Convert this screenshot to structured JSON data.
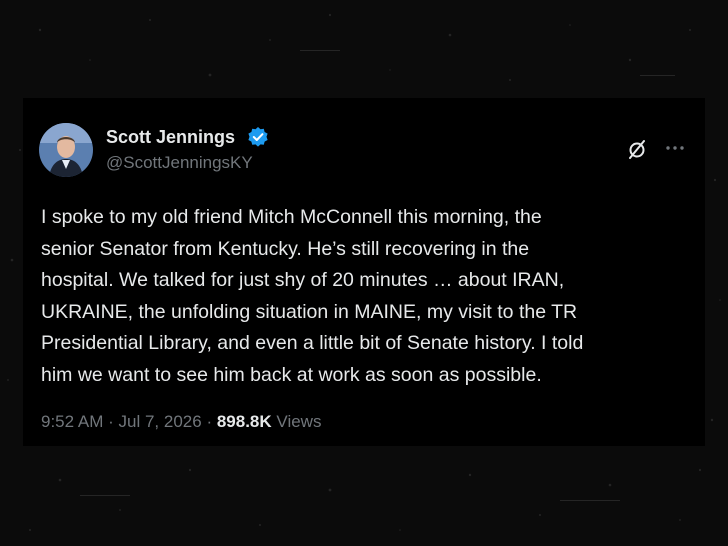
{
  "author": {
    "display_name": "Scott Jennings",
    "handle": "@ScottJenningsKY",
    "verified": true
  },
  "tweet": {
    "text_lines": [
      "I spoke to my old friend Mitch McConnell this morning, the",
      "senior Senator from Kentucky. He’s still recovering in the",
      "hospital. We talked for just shy of 20 minutes … about IRAN,",
      "UKRAINE, the unfolding situation in MAINE, my visit to the TR",
      "Presidential Library, and even a little bit of Senate history. I told",
      "him we want to see him back at work as soon as possible."
    ]
  },
  "meta": {
    "time": "9:52 AM",
    "separator": "·",
    "date": "Jul 7, 2026",
    "views_count": "898.8K",
    "views_label": "Views"
  },
  "icons": {
    "verified": "verified-badge-icon",
    "grok": "grok-icon",
    "more": "more-options-icon"
  },
  "colors": {
    "background": "#000000",
    "text_primary": "#e7e9ea",
    "text_secondary": "#71767b",
    "verified_blue": "#1d9bf0"
  }
}
